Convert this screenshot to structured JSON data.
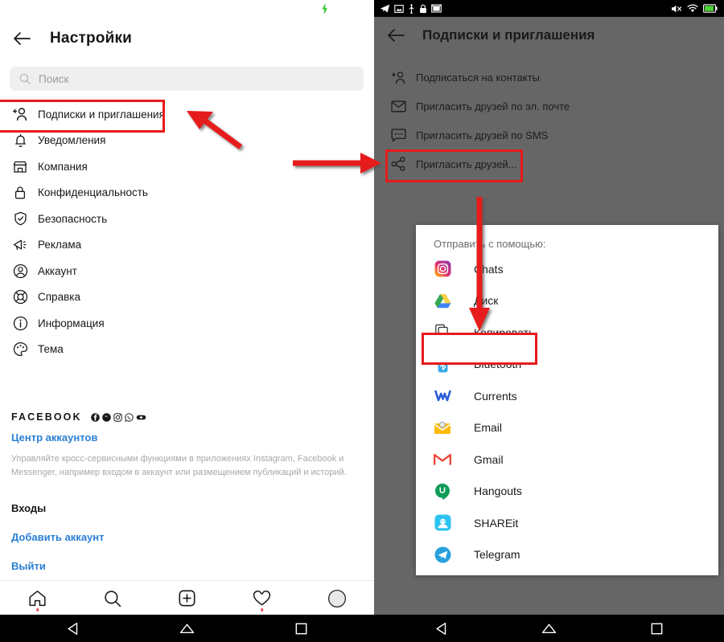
{
  "left_phone": {
    "status_bar": {
      "charging_icon": "battery-charging-icon"
    },
    "header": {
      "back_icon": "back-arrow-icon",
      "title": "Настройки"
    },
    "search": {
      "icon": "search-icon",
      "placeholder": "Поиск"
    },
    "menu_items": [
      {
        "icon": "follow-person-icon",
        "label": "Подписки и приглашения",
        "highlighted": true
      },
      {
        "icon": "bell-icon",
        "label": "Уведомления"
      },
      {
        "icon": "store-icon",
        "label": "Компания"
      },
      {
        "icon": "lock-icon",
        "label": "Конфиденциальность"
      },
      {
        "icon": "shield-check-icon",
        "label": "Безопасность"
      },
      {
        "icon": "megaphone-icon",
        "label": "Реклама"
      },
      {
        "icon": "account-circle-icon",
        "label": "Аккаунт"
      },
      {
        "icon": "lifebuoy-icon",
        "label": "Справка"
      },
      {
        "icon": "info-circle-icon",
        "label": "Информация"
      },
      {
        "icon": "palette-icon",
        "label": "Тема"
      }
    ],
    "facebook_block": {
      "brand": "FACEBOOK",
      "brand_icons": [
        "facebook-icon",
        "messenger-icon",
        "instagram-icon",
        "whatsapp-icon",
        "oculus-icon"
      ],
      "accounts_center_link": "Центр аккаунтов",
      "description": "Управляйте кросс-сервисными функциями в приложениях Instagram, Facebook и Messenger, например входом в аккаунт или размещением публикаций и историй.",
      "logins_heading": "Входы",
      "add_account_link": "Добавить аккаунт",
      "logout_link": "Выйти"
    },
    "tab_bar": [
      {
        "icon": "home-icon",
        "badge": true
      },
      {
        "icon": "search-icon",
        "badge": false
      },
      {
        "icon": "add-post-icon",
        "badge": false
      },
      {
        "icon": "heart-icon",
        "badge": true
      },
      {
        "icon": "profile-avatar-icon",
        "badge": false
      }
    ],
    "nav_bar": [
      {
        "icon": "android-back-icon"
      },
      {
        "icon": "android-home-icon"
      },
      {
        "icon": "android-recents-icon"
      }
    ]
  },
  "right_phone": {
    "status_bar": {
      "left_icons": [
        "telegram-icon",
        "screenshot-icon",
        "usb-icon",
        "lock-icon",
        "mail-icon"
      ],
      "right_icons": [
        "mute-icon",
        "wifi-icon",
        "battery-icon"
      ]
    },
    "header": {
      "back_icon": "back-arrow-icon",
      "title": "Подписки и приглашения"
    },
    "menu_items": [
      {
        "icon": "follow-person-icon",
        "label": "Подписаться на контакты"
      },
      {
        "icon": "envelope-icon",
        "label": "Пригласить друзей по эл. почте"
      },
      {
        "icon": "sms-bubble-icon",
        "label": "Пригласить друзей по SMS"
      },
      {
        "icon": "share-nodes-icon",
        "label": "Пригласить друзей...",
        "highlighted": true
      }
    ],
    "share_sheet": {
      "title": "Отправить с помощью:",
      "apps": [
        {
          "icon": "instagram-icon",
          "label": "Chats"
        },
        {
          "icon": "google-drive-icon",
          "label": "Диск"
        },
        {
          "icon": "copy-icon",
          "label": "Копировать",
          "highlighted": true
        },
        {
          "icon": "bluetooth-icon",
          "label": "Bluetooth"
        },
        {
          "icon": "currents-icon",
          "label": "Currents"
        },
        {
          "icon": "email-icon",
          "label": "Email"
        },
        {
          "icon": "gmail-icon",
          "label": "Gmail"
        },
        {
          "icon": "hangouts-icon",
          "label": "Hangouts"
        },
        {
          "icon": "shareit-icon",
          "label": "SHAREit"
        },
        {
          "icon": "telegram-icon",
          "label": "Telegram"
        }
      ]
    },
    "nav_bar": [
      {
        "icon": "android-back-icon"
      },
      {
        "icon": "android-home-icon"
      },
      {
        "icon": "android-recents-icon"
      }
    ]
  },
  "annotations": {
    "accent_color": "#e61b1b",
    "arrows": [
      {
        "name": "arrow-to-follow-invite",
        "direction": "up-left"
      },
      {
        "name": "arrow-to-invite-friends",
        "direction": "right"
      },
      {
        "name": "arrow-to-copy",
        "direction": "down"
      }
    ]
  }
}
